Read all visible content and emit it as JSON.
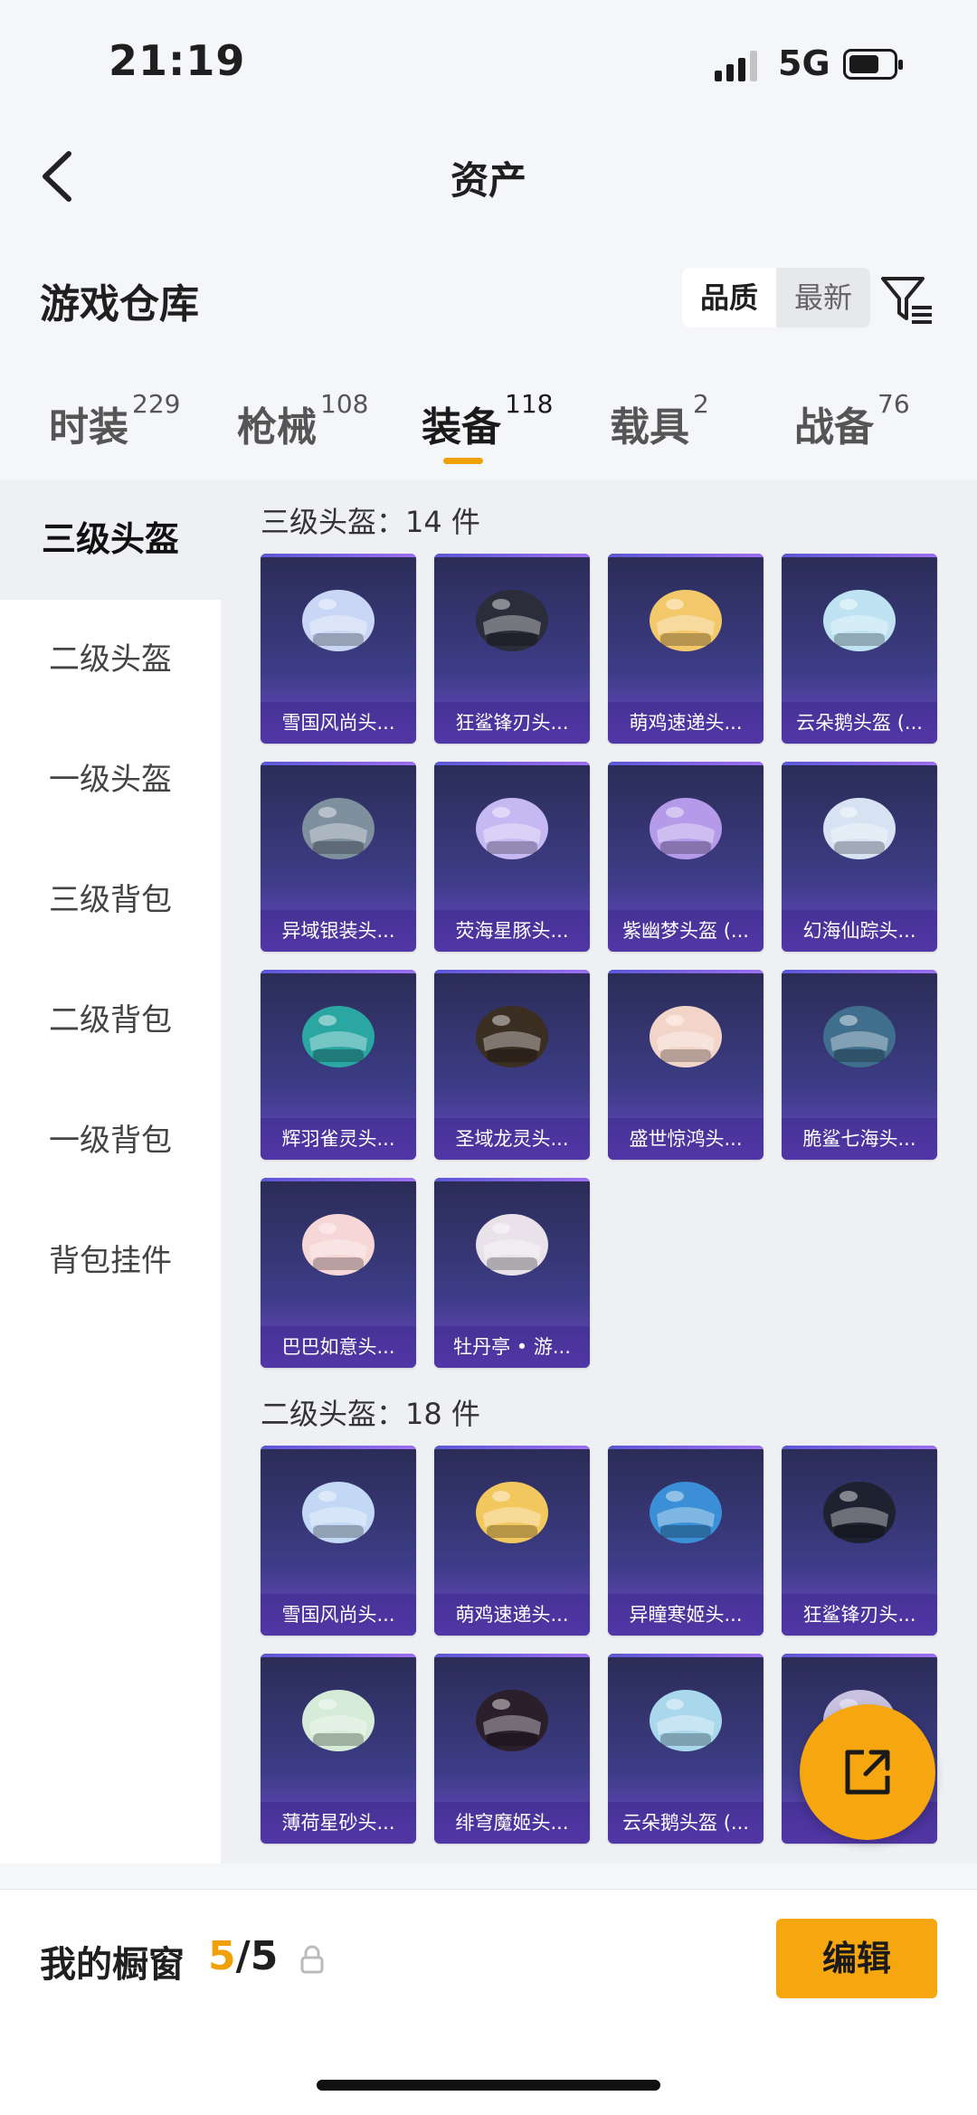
{
  "status_bar": {
    "time": "21:19",
    "network": "5G"
  },
  "nav": {
    "title": "资产"
  },
  "section": {
    "title": "游戏仓库",
    "sort_options": [
      "品质",
      "最新"
    ],
    "active_sort": "品质"
  },
  "tabs": [
    {
      "label": "时装",
      "count": "229"
    },
    {
      "label": "枪械",
      "count": "108"
    },
    {
      "label": "装备",
      "count": "118",
      "active": true
    },
    {
      "label": "载具",
      "count": "2"
    },
    {
      "label": "战备",
      "count": "76"
    }
  ],
  "sidebar": {
    "items": [
      "三级头盔",
      "二级头盔",
      "一级头盔",
      "三级背包",
      "二级背包",
      "一级背包",
      "背包挂件"
    ],
    "active": "三级头盔"
  },
  "groups": [
    {
      "header": "三级头盔：14 件",
      "items": [
        "雪国风尚头...",
        "狂鲨锋刃头...",
        "萌鸡速递头...",
        "云朵鹅头盔 (...",
        "异域银装头...",
        "荧海星豚头...",
        "紫幽梦头盔 (...",
        "幻海仙踪头...",
        "辉羽雀灵头...",
        "圣域龙灵头...",
        "盛世惊鸿头...",
        "脆鲨七海头...",
        "巴巴如意头...",
        "牡丹亭 • 游..."
      ]
    },
    {
      "header": "二级头盔：18 件",
      "items": [
        "雪国风尚头...",
        "萌鸡速递头...",
        "异瞳寒姬头...",
        "狂鲨锋刃头...",
        "薄荷星砂头...",
        "绯穹魔姬头...",
        "云朵鹅头盔 (...",
        "幻星..."
      ]
    }
  ],
  "helmet_colors": [
    "#c9d6f5",
    "#2b2d3a",
    "#f3c86a",
    "#bfe3f2",
    "#7e8f9e",
    "#c6b8f2",
    "#b49ae8",
    "#d7e3f3",
    "#2aa6a3",
    "#3b2e22",
    "#f2d5c8",
    "#3f6f8c",
    "#f6d6d6",
    "#e9e2ea",
    "#c2d8f4",
    "#f2c75e",
    "#3a8fd6",
    "#1e2230",
    "#d6ecd8",
    "#2c1f2c",
    "#a9d8ec",
    "#c8c2e0"
  ],
  "bottom": {
    "showcase_label": "我的橱窗",
    "count_current": "5",
    "count_total": "/5",
    "edit_label": "编辑"
  },
  "colors": {
    "accent": "#f6a60e",
    "card_bg": "#3d3c87",
    "card_glow": "#6c48c6"
  }
}
